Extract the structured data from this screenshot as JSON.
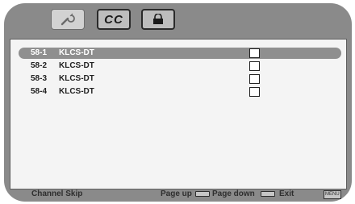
{
  "tabs": [
    {
      "icon": "wrench-icon",
      "selected": true
    },
    {
      "label": "CC",
      "icon": "cc-icon",
      "selected": false
    },
    {
      "icon": "lock-icon",
      "selected": false
    }
  ],
  "channels": [
    {
      "number": "58-1",
      "name": "KLCS-DT",
      "skipped": false,
      "selected": true
    },
    {
      "number": "58-2",
      "name": "KLCS-DT",
      "skipped": false,
      "selected": false
    },
    {
      "number": "58-3",
      "name": "KLCS-DT",
      "skipped": false,
      "selected": false
    },
    {
      "number": "58-4",
      "name": "KLCS-DT",
      "skipped": false,
      "selected": false
    }
  ],
  "footer": {
    "title": "Channel  Skip",
    "page_up": "Page up",
    "page_down": "Page down",
    "exit": "Exit",
    "menu_key": "MENU"
  },
  "colors": {
    "frame": "#8a8a8a",
    "panel": "#f4f4f4",
    "highlight": "#8f8f8f"
  }
}
